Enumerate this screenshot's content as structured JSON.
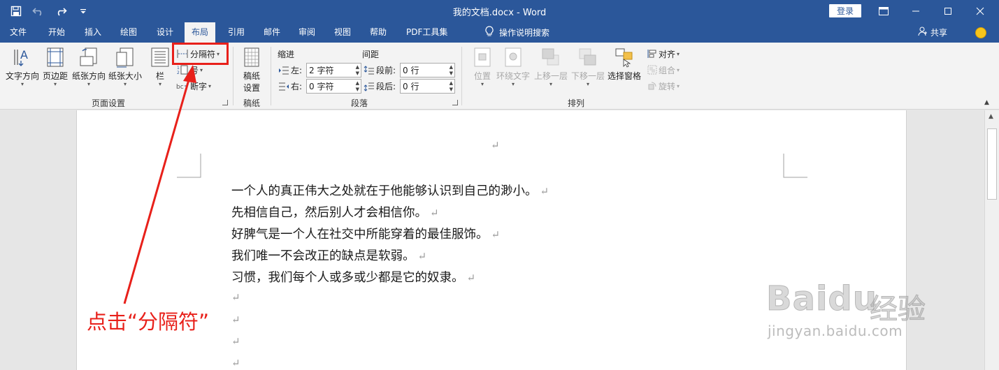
{
  "window": {
    "title": "我的文档.docx  -  Word",
    "login_label": "登录"
  },
  "tabs": [
    {
      "label": "文件"
    },
    {
      "label": "开始"
    },
    {
      "label": "插入"
    },
    {
      "label": "绘图"
    },
    {
      "label": "设计"
    },
    {
      "label": "布局"
    },
    {
      "label": "引用"
    },
    {
      "label": "邮件"
    },
    {
      "label": "审阅"
    },
    {
      "label": "视图"
    },
    {
      "label": "帮助"
    },
    {
      "label": "PDF工具集"
    }
  ],
  "tell_me": "操作说明搜索",
  "share": "共享",
  "ribbon": {
    "page_setup": {
      "label": "页面设置",
      "text_direction": "文字方向",
      "margins": "页边距",
      "orientation": "纸张方向",
      "size": "纸张大小",
      "columns": "栏",
      "breaks": "分隔符",
      "line_numbers": "号",
      "hyphenation": "断字"
    },
    "manuscript": {
      "label": "稿纸",
      "setup_line1": "稿纸",
      "setup_line2": "设置"
    },
    "paragraph": {
      "label": "段落",
      "indent_head": "缩进",
      "spacing_head": "间距",
      "left_label": "左:",
      "left_value": "2 字符",
      "right_label": "右:",
      "right_value": "0 字符",
      "before_label": "段前:",
      "before_value": "0 行",
      "after_label": "段后:",
      "after_value": "0 行"
    },
    "arrange": {
      "label": "排列",
      "position": "位置",
      "wrap_text": "环绕文字",
      "bring_forward": "上移一层",
      "send_backward": "下移一层",
      "selection_pane": "选择窗格",
      "align": "对齐",
      "group": "组合",
      "rotate": "旋转"
    }
  },
  "document": {
    "paragraphs": [
      "一个人的真正伟大之处就在于他能够认识到自己的渺小。",
      "先相信自己，然后别人才会相信你。",
      "好脾气是一个人在社交中所能穿着的最佳服饰。",
      "我们唯一不会改正的缺点是软弱。",
      "习惯，我们每个人或多或少都是它的奴隶。"
    ],
    "paragraph_mark": "↵"
  },
  "annotation": {
    "text": "点击“分隔符”"
  },
  "watermark": {
    "brand": "Baidu",
    "brand_cn": "经验",
    "url": "jingyan.baidu.com"
  },
  "colors": {
    "brand_blue": "#2b579a",
    "annotation_red": "#e8201a"
  }
}
